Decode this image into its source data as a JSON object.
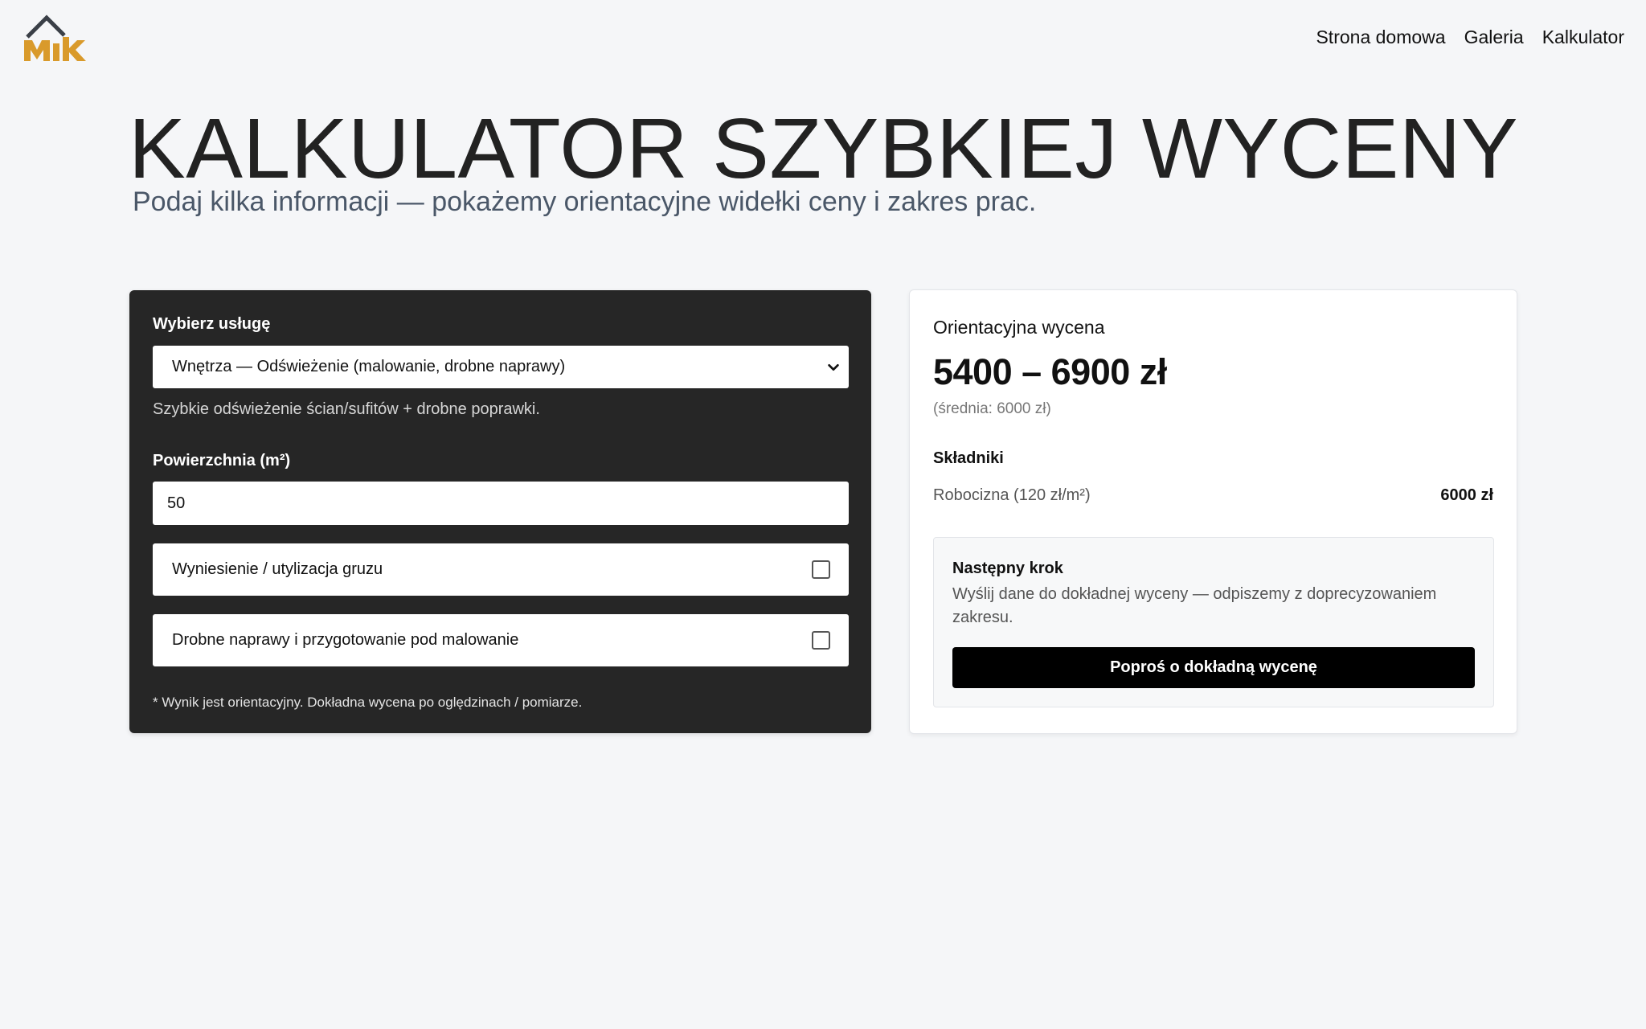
{
  "header": {
    "logo_text": "MIK",
    "nav": [
      "Strona domowa",
      "Galeria",
      "Kalkulator"
    ]
  },
  "hero": {
    "title": "KALKULATOR SZYBKIEJ WYCENY",
    "subtitle": "Podaj kilka informacji — pokażemy orientacyjne widełki ceny i zakres prac."
  },
  "form": {
    "service_label": "Wybierz usługę",
    "service_selected": "Wnętrza — Odświeżenie (malowanie, drobne naprawy)",
    "service_hint": "Szybkie odświeżenie ścian/sufitów + drobne poprawki.",
    "area_label": "Powierzchnia (m²)",
    "area_value": "50",
    "options": [
      {
        "label": "Wyniesienie / utylizacja gruzu",
        "checked": false
      },
      {
        "label": "Drobne naprawy i przygotowanie pod malowanie",
        "checked": false
      }
    ],
    "footnote": "* Wynik jest orientacyjny. Dokładna wycena po oględzinach / pomiarze."
  },
  "estimate": {
    "title": "Orientacyjna wycena",
    "price_range": "5400 – 6900 zł",
    "average": "(średnia: 6000 zł)",
    "components_title": "Składniki",
    "components": [
      {
        "name": "Robocizna (120 zł/m²)",
        "value": "6000 zł"
      }
    ],
    "next_step": {
      "title": "Następny krok",
      "text": "Wyślij dane do dokładnej wyceny — odpiszemy z doprecyzowaniem zakresu.",
      "button": "Poproś o dokładną wycenę"
    }
  },
  "colors": {
    "background": "#f5f6f8",
    "dark_card": "#262626",
    "logo_gold": "#d99a2b",
    "logo_roof": "#3a3f47",
    "cta": "#000000"
  },
  "icons": {
    "select_arrow": "chevron-down-icon"
  }
}
